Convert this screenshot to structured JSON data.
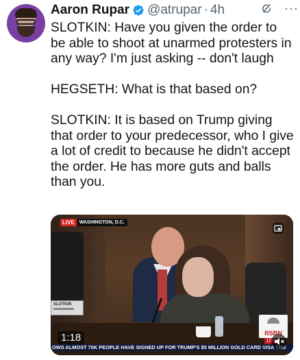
{
  "author": {
    "name": "Aaron Rupar",
    "handle": "@atrupar",
    "separator": "·",
    "time": "4h",
    "more": "···"
  },
  "tweet": {
    "p1": "SLOTKIN: Have you given the order to be able to shoot at unarmed protesters in any way? I'm just asking -- don't laugh",
    "p2": "HEGSETH: What is that based on?",
    "p3": "SLOTKIN: It is based on Trump giving that order to your predecessor, who I give a lot of credit to because he didn't accept the order. He has more guts and balls than you."
  },
  "video": {
    "live_label": "LIVE",
    "location": "WASHINGTON, D.C.",
    "nameplate": "SLOTKIN",
    "duration": "1:18",
    "ticker": "OWS    ALMOST 70K PEOPLE HAVE SIGNED UP FOR TRUMP'S $5 MILLION GOLD CARD VISA    TRU",
    "logo": "RSBN",
    "clock": "12:0"
  },
  "icons": {
    "verified": "verified-badge-icon",
    "grok": "grok-icon",
    "more": "more-icon",
    "pip": "pip-icon",
    "sound": "volume-muted-icon"
  },
  "colors": {
    "verified": "#1d9bf0",
    "live": "#d2231f",
    "secondary_text": "#536471"
  }
}
